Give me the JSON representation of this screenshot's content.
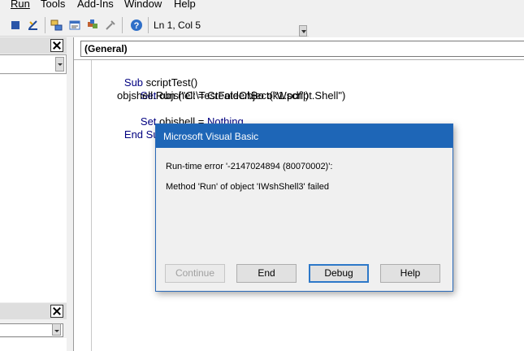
{
  "menu": [
    {
      "label": "Run",
      "mnemonic": "R"
    },
    {
      "label": "Tools",
      "mnemonic": "T"
    },
    {
      "label": "Add-Ins",
      "mnemonic": "A"
    },
    {
      "label": "Window",
      "mnemonic": "W"
    },
    {
      "label": "Help",
      "mnemonic": "H"
    }
  ],
  "toolbar": {
    "icons": [
      "stop-icon",
      "design-mode-icon",
      "project-explorer-icon",
      "properties-window-icon",
      "object-browser-icon",
      "toolbox-icon",
      "help-icon"
    ],
    "position": "Ln 1, Col 5"
  },
  "code_window": {
    "object_combo": "(General)",
    "lines": [
      "Sub scriptTest()",
      "Set objshell = CreateObject(\"Wscript.Shell\")",
      "objshell.Run (\"C:\\TestFolder\\Bo ok1.pdf\")",
      "Set objshell = Nothing",
      "End Sub"
    ]
  },
  "dialog": {
    "title": "Microsoft Visual Basic",
    "error_line": "Run-time error '-2147024894 (80070002)':",
    "message": "Method 'Run' of object 'IWshShell3' failed",
    "buttons": {
      "continue": "Continue",
      "end": "End",
      "debug": "Debug",
      "help": "Help"
    }
  },
  "colors": {
    "dialog_title_bar": "#1e66b7",
    "keyword": "#000080",
    "default_button_border": "#2d78c8"
  }
}
